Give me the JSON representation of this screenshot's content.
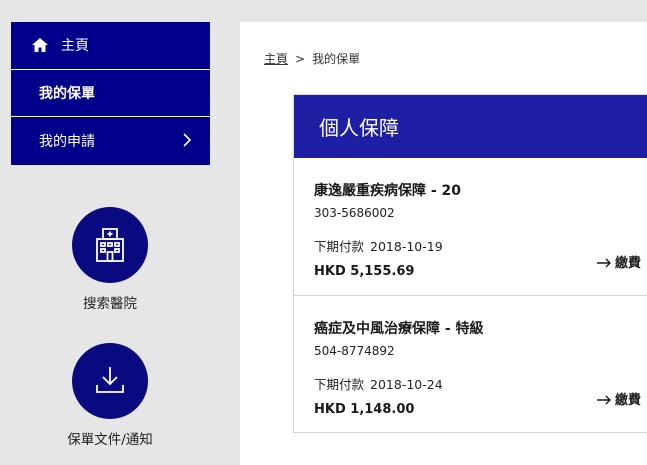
{
  "sidebar": {
    "items": [
      {
        "label": "主頁",
        "icon": "home-icon"
      },
      {
        "label": "我的保單"
      },
      {
        "label": "我的申請",
        "icon": "chevron-right-icon"
      }
    ],
    "quick_links": [
      {
        "label": "搜索醫院",
        "icon": "hospital-icon"
      },
      {
        "label": "保單文件/通知",
        "icon": "download-icon"
      }
    ]
  },
  "breadcrumb": {
    "home": "主頁",
    "separator": ">",
    "current": "我的保單"
  },
  "card": {
    "title": "個人保障",
    "policies": [
      {
        "name": "康逸嚴重疾病保障 - 20",
        "number": "303-5686002",
        "due_label": "下期付款",
        "due_date": "2018-10-19",
        "amount": "HKD 5,155.69",
        "pay_label": "繳費"
      },
      {
        "name": "癌症及中風治療保障 - 特級",
        "number": "504-8774892",
        "due_label": "下期付款",
        "due_date": "2018-10-24",
        "amount": "HKD 1,148.00",
        "pay_label": "繳費"
      }
    ]
  },
  "colors": {
    "nav_bg": "#00008b",
    "card_header_bg": "#1f1fa6",
    "circle_bg": "#0a0a80",
    "page_bg": "#e6e6e6"
  }
}
